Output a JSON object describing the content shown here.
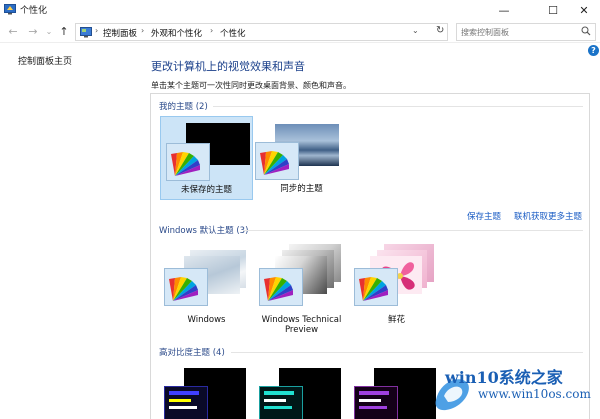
{
  "window": {
    "title": "个性化",
    "min_glyph": "—",
    "max_glyph": "☐",
    "close_glyph": "✕"
  },
  "nav": {
    "back_glyph": "←",
    "forward_glyph": "→",
    "recent_glyph": "⌄",
    "up_glyph": "↑"
  },
  "address": {
    "breadcrumbs": [
      "控制面板",
      "外观和个性化",
      "个性化"
    ],
    "separator": "›",
    "leading_sep": "›",
    "dropdown_glyph": "⌄",
    "refresh_glyph": "↻"
  },
  "search": {
    "placeholder": "搜索控制面板"
  },
  "left_nav": {
    "home_link": "控制面板主页"
  },
  "help_glyph": "?",
  "main": {
    "title": "更改计算机上的视觉效果和声音",
    "subtitle": "单击某个主题可一次性同时更改桌面背景、颜色和声音。"
  },
  "sections": {
    "my_themes": {
      "label": "我的主题",
      "count": "(2)",
      "items": [
        {
          "label": "未保存的主题",
          "selected": true
        },
        {
          "label": "同步的主题",
          "selected": false
        }
      ],
      "actions": [
        "保存主题",
        "联机获取更多主题"
      ]
    },
    "default_themes": {
      "label": "Windows 默认主题",
      "count": "(3)",
      "items": [
        {
          "label": "Windows"
        },
        {
          "label_line1": "Windows Technical",
          "label_line2": "Preview"
        },
        {
          "label": "鲜花"
        }
      ]
    },
    "high_contrast": {
      "label": "高对比度主题",
      "count": "(4)"
    }
  },
  "colors": {
    "accent": "#1a73c8",
    "link": "#1a5cc4",
    "title_blue": "#1a3f8a",
    "selection": "#cce4f7"
  },
  "watermark": {
    "title": "win10系统之家",
    "url": "www.win10os.com"
  }
}
